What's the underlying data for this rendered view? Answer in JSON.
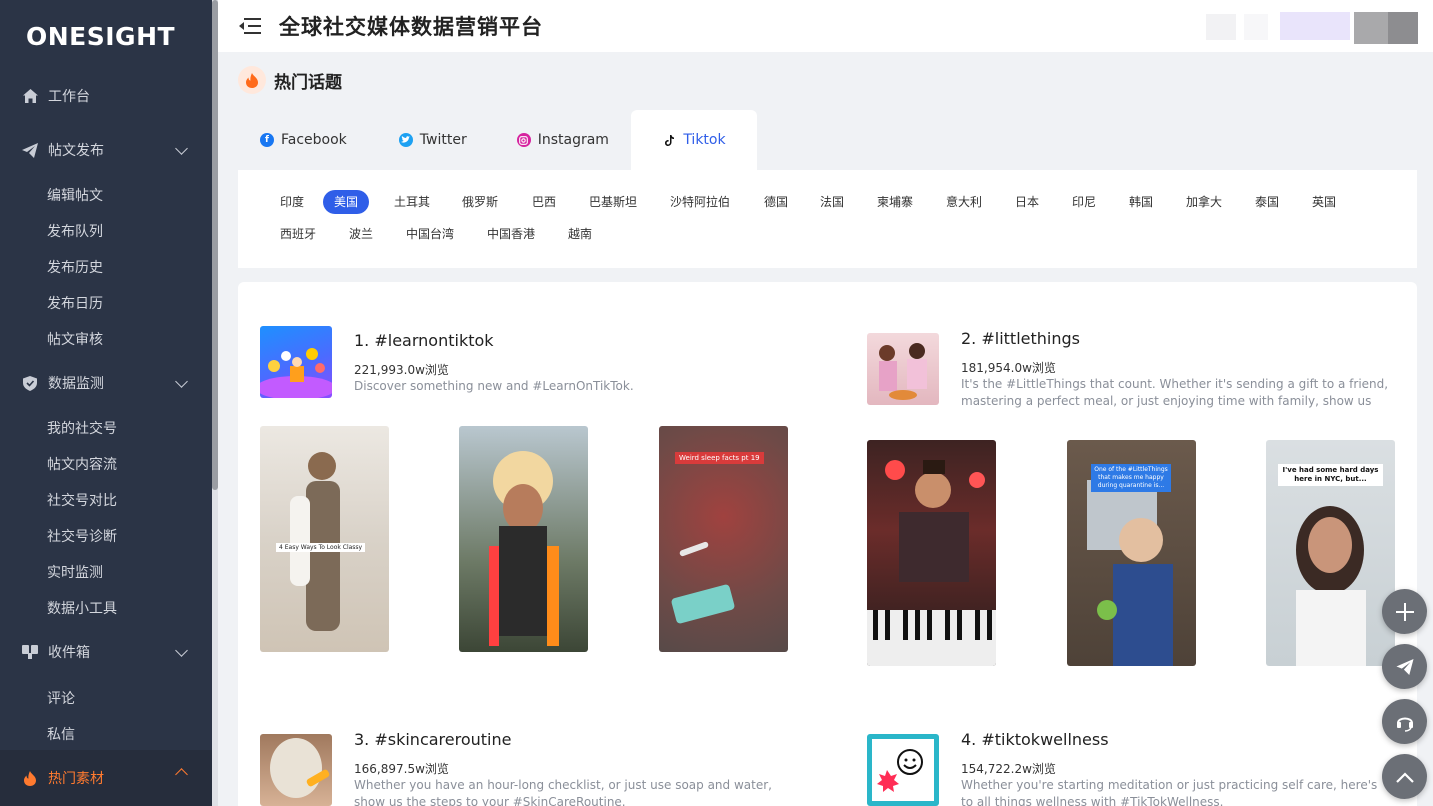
{
  "app": {
    "logo": "ONESIGHT",
    "title": "全球社交媒体数据营销平台"
  },
  "sidebar": {
    "items": [
      {
        "label": "工作台"
      },
      {
        "label": "帖文发布"
      },
      {
        "label": "编辑帖文"
      },
      {
        "label": "发布队列"
      },
      {
        "label": "发布历史"
      },
      {
        "label": "发布日历"
      },
      {
        "label": "帖文审核"
      },
      {
        "label": "数据监测"
      },
      {
        "label": "我的社交号"
      },
      {
        "label": "帖文内容流"
      },
      {
        "label": "社交号对比"
      },
      {
        "label": "社交号诊断"
      },
      {
        "label": "实时监测"
      },
      {
        "label": "数据小工具"
      },
      {
        "label": "收件箱"
      },
      {
        "label": "评论"
      },
      {
        "label": "私信"
      },
      {
        "label": "热门素材"
      }
    ],
    "colors": {
      "bg": "#2b3446",
      "active": "#ff7a2f"
    }
  },
  "page": {
    "title": "热门话题"
  },
  "tabs": [
    {
      "label": "Facebook",
      "icon": "facebook-icon"
    },
    {
      "label": "Twitter",
      "icon": "twitter-icon"
    },
    {
      "label": "Instagram",
      "icon": "instagram-icon"
    },
    {
      "label": "Tiktok",
      "icon": "tiktok-icon",
      "active": true
    }
  ],
  "countries": [
    "印度",
    "美国",
    "土耳其",
    "俄罗斯",
    "巴西",
    "巴基斯坦",
    "沙特阿拉伯",
    "德国",
    "法国",
    "柬埔寨",
    "意大利",
    "日本",
    "印尼",
    "韩国",
    "加拿大",
    "泰国",
    "英国",
    "西班牙",
    "波兰",
    "中国台湾",
    "中国香港",
    "越南"
  ],
  "selected_country": "美国",
  "topics": [
    {
      "rank_title": "1. #learnontiktok",
      "views": "221,993.0w浏览",
      "desc": "Discover something new and #LearnOnTikTok.",
      "video_captions": [
        "4 Easy Ways To Look Classy",
        "",
        "Weird sleep facts pt 19"
      ]
    },
    {
      "rank_title": "2. #littlethings",
      "views": "181,954.0w浏览",
      "desc": "It's the #LittleThings that count. Whether it's sending a gift to a friend, mastering a perfect meal, or just enjoying time with family, show us those...",
      "video_captions": [
        "",
        "One of the #LittleThings that makes me happy during quarantine is...",
        "I've had some hard days here in NYC, but..."
      ]
    },
    {
      "rank_title": "3. #skincareroutine",
      "views": "166,897.5w浏览",
      "desc": "Whether you have an hour-long checklist, or just use soap and water, show us the steps to your #SkinCareRoutine."
    },
    {
      "rank_title": "4. #tiktokwellness",
      "views": "154,722.2w浏览",
      "desc": "Whether you're starting meditation or just practicing self care, here's to all things wellness with #TikTokWellness."
    }
  ],
  "accent": "#2f5ee8"
}
